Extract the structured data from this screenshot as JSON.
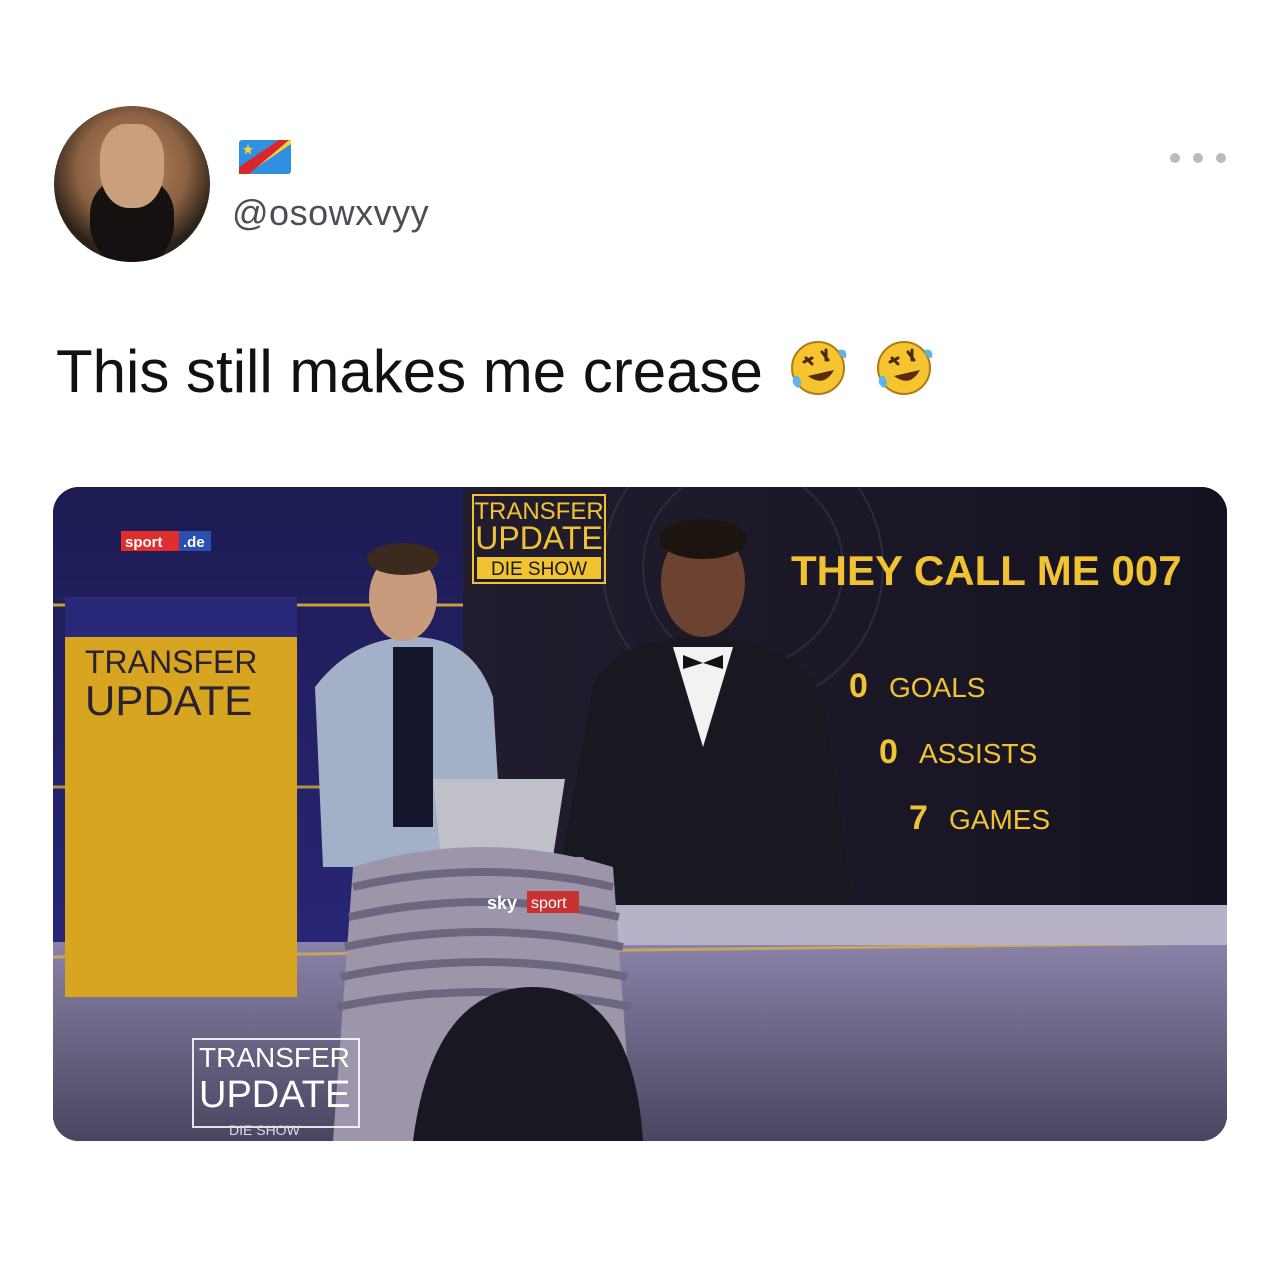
{
  "tweet": {
    "handle": "@osowxvyy",
    "text": "This still makes me crease",
    "emoji": [
      "rolling-on-floor-laughing",
      "rolling-on-floor-laughing"
    ],
    "more_icon": "more-horizontal-icon",
    "flag_icon": "dr-congo-flag-icon"
  },
  "media": {
    "logo_left": "sport",
    "logo_right": ".de",
    "top_box": [
      "TRANSFER",
      "UPDATE",
      "DIE SHOW"
    ],
    "left_panel": [
      "TRANSFER",
      "UPDATE"
    ],
    "headline": "THEY CALL ME 007",
    "stats": [
      {
        "num": "0",
        "label": "GOALS"
      },
      {
        "num": "0",
        "label": "ASSISTS"
      },
      {
        "num": "7",
        "label": "GAMES"
      }
    ],
    "desk_logo_1": "sky",
    "desk_logo_2": "sport",
    "bottom_box": [
      "TRANSFER",
      "UPDATE",
      "DIE SHOW"
    ]
  },
  "colors": {
    "accent_yellow": "#f1c232",
    "studio_blue": "#2b2a7a",
    "screen_dark": "#1a1822"
  }
}
